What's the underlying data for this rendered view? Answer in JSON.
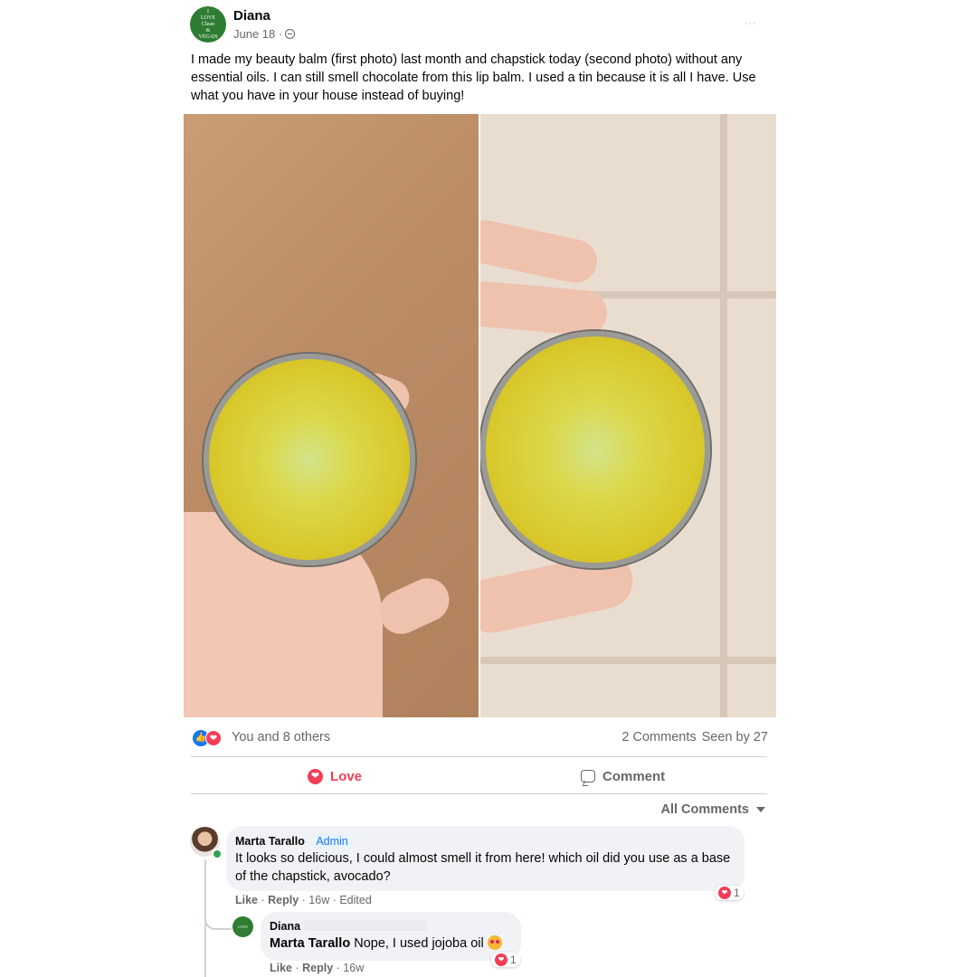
{
  "post": {
    "author": "Diana",
    "avatar_text": [
      "I",
      "LOVE",
      "Clean",
      "&",
      "VEGAN"
    ],
    "date": "June 18 ·",
    "more_label": "···",
    "text": "I made my beauty balm (first photo) last month and chapstick today (second photo) without any essential oils.  I can still smell chocolate from this lip balm.  I used a tin because it is all I have.  Use what you have in your house instead of buying!"
  },
  "reactions": {
    "summary": "You and 8 others",
    "comments_count": "2 Comments",
    "seen_by": "Seen by 27"
  },
  "actions": {
    "love": "Love",
    "comment": "Comment"
  },
  "comments_filter": "All Comments",
  "comments": [
    {
      "author": "Marta Tarallo",
      "badge": "Admin",
      "text": "It looks so delicious, I could almost smell it from here! which oil did you use as a base of the chapstick, avocado?",
      "like": "Like",
      "reply": "Reply",
      "meta": "· 16w · Edited",
      "reaction_count": "1"
    },
    {
      "author": "Diana",
      "mention": "Marta Tarallo",
      "text": " Nope, I used jojoba oil",
      "like": "Like",
      "reply": "Reply",
      "meta": "· 16w",
      "reaction_count": "1"
    }
  ],
  "colors": {
    "love": "#f33e58",
    "like": "#1877f2",
    "secondary_text": "#65676b",
    "bubble": "#f0f2f5"
  },
  "icons": [
    "globe-icon",
    "more-icon",
    "like-reaction-icon",
    "love-reaction-icon",
    "love-icon",
    "comment-icon",
    "chevron-down-icon"
  ]
}
